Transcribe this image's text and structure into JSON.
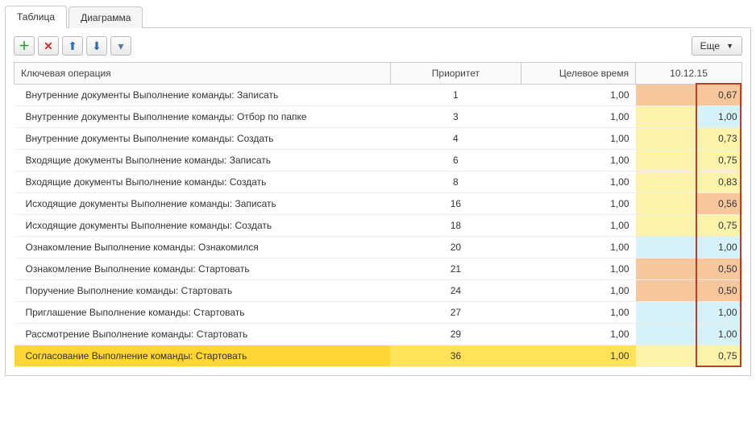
{
  "tabs": {
    "table": "Таблица",
    "chart": "Диаграмма"
  },
  "toolbar": {
    "more": "Еще"
  },
  "columns": {
    "operation": "Ключевая операция",
    "priority": "Приоритет",
    "target": "Целевое время",
    "date": "10.12.15"
  },
  "colors": {
    "orange": "#f6c79d",
    "yellow": "#fcf3aa",
    "blue": "#d6f1f8"
  },
  "rows": [
    {
      "op": "Внутренние документы Выполнение команды: Записать",
      "pr": "1",
      "tgt": "1,00",
      "date": "0,67",
      "lc": "orange",
      "rc": "orange"
    },
    {
      "op": "Внутренние документы Выполнение команды: Отбор по папке",
      "pr": "3",
      "tgt": "1,00",
      "date": "1,00",
      "lc": "yellow",
      "rc": "blue"
    },
    {
      "op": "Внутренние документы Выполнение команды: Создать",
      "pr": "4",
      "tgt": "1,00",
      "date": "0,73",
      "lc": "yellow",
      "rc": "yellow"
    },
    {
      "op": "Входящие документы Выполнение команды: Записать",
      "pr": "6",
      "tgt": "1,00",
      "date": "0,75",
      "lc": "yellow",
      "rc": "yellow"
    },
    {
      "op": "Входящие документы Выполнение команды: Создать",
      "pr": "8",
      "tgt": "1,00",
      "date": "0,83",
      "lc": "yellow",
      "rc": "yellow"
    },
    {
      "op": "Исходящие документы Выполнение команды: Записать",
      "pr": "16",
      "tgt": "1,00",
      "date": "0,56",
      "lc": "yellow",
      "rc": "orange"
    },
    {
      "op": "Исходящие документы Выполнение команды: Создать",
      "pr": "18",
      "tgt": "1,00",
      "date": "0,75",
      "lc": "yellow",
      "rc": "yellow"
    },
    {
      "op": "Ознакомление Выполнение команды: Ознакомился",
      "pr": "20",
      "tgt": "1,00",
      "date": "1,00",
      "lc": "blue",
      "rc": "blue"
    },
    {
      "op": "Ознакомление Выполнение команды: Стартовать",
      "pr": "21",
      "tgt": "1,00",
      "date": "0,50",
      "lc": "orange",
      "rc": "orange"
    },
    {
      "op": "Поручение Выполнение команды: Стартовать",
      "pr": "24",
      "tgt": "1,00",
      "date": "0,50",
      "lc": "orange",
      "rc": "orange"
    },
    {
      "op": "Приглашение Выполнение команды: Стартовать",
      "pr": "27",
      "tgt": "1,00",
      "date": "1,00",
      "lc": "blue",
      "rc": "blue"
    },
    {
      "op": "Рассмотрение Выполнение команды: Стартовать",
      "pr": "29",
      "tgt": "1,00",
      "date": "1,00",
      "lc": "blue",
      "rc": "blue"
    },
    {
      "op": "Согласование Выполнение команды: Стартовать",
      "pr": "36",
      "tgt": "1,00",
      "date": "0,75",
      "lc": "yellow",
      "rc": "yellow",
      "sel": true
    }
  ]
}
